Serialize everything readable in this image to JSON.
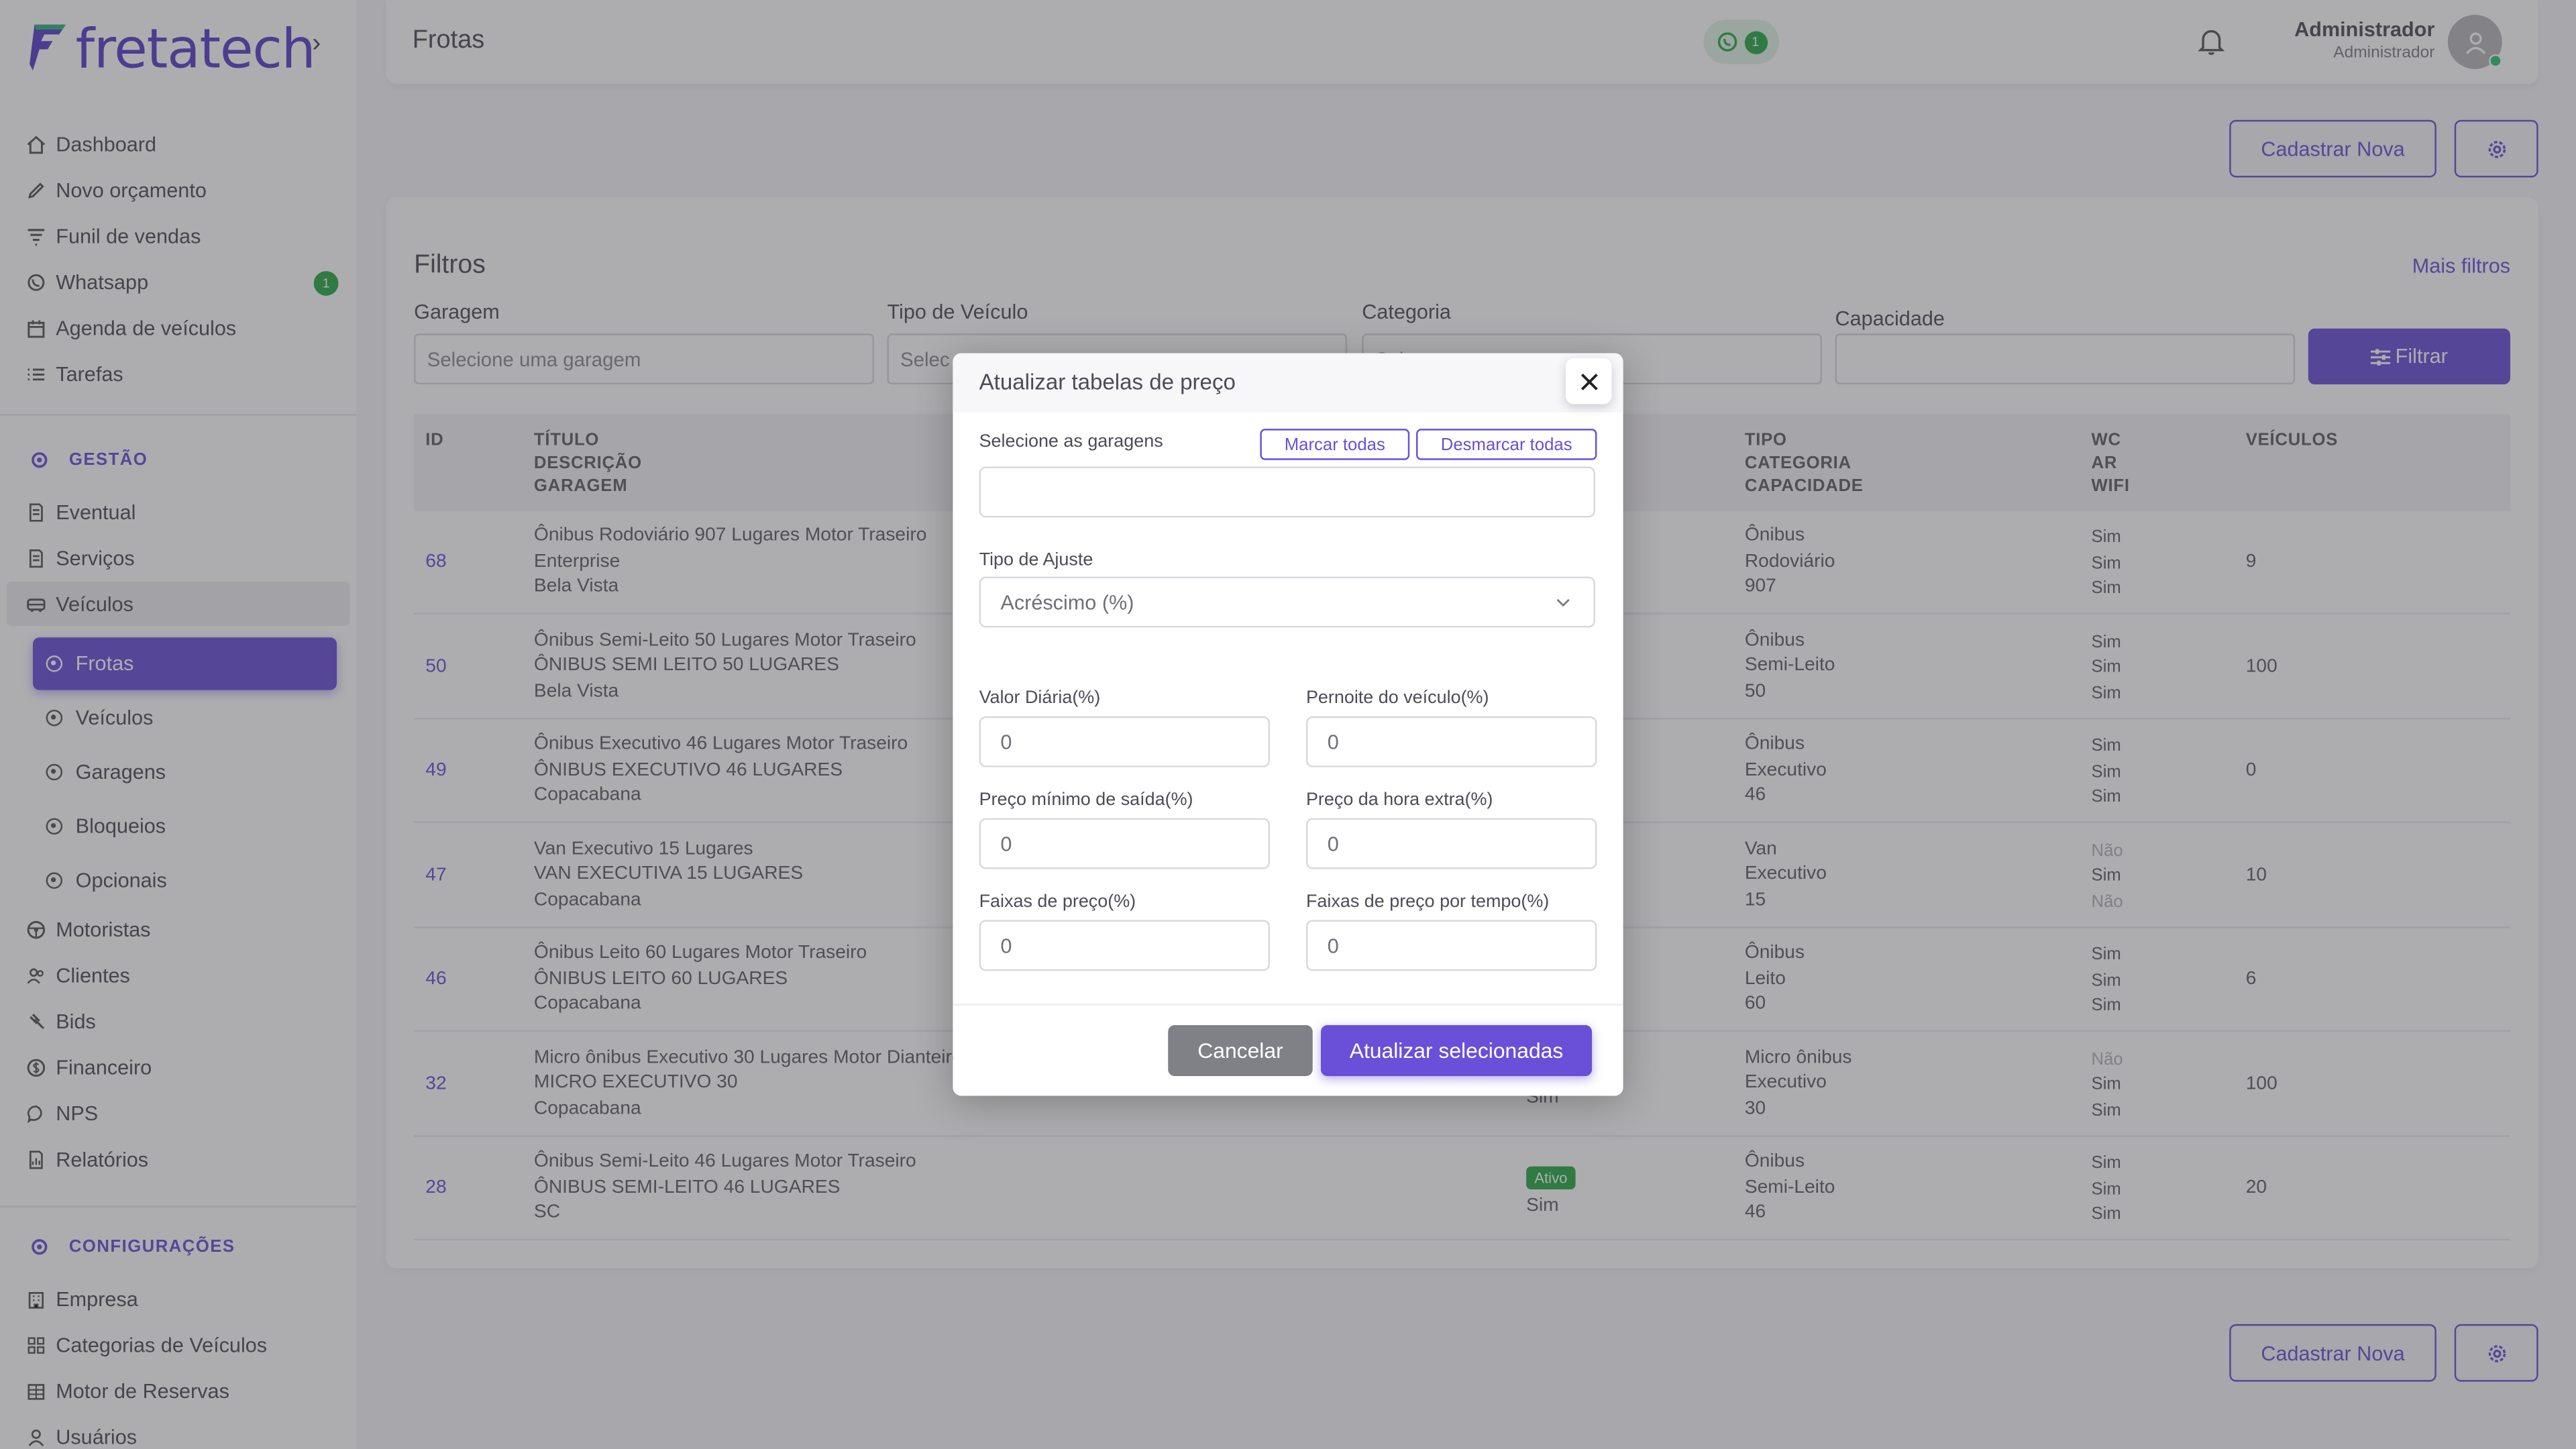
{
  "brand": {
    "name": "fretatech",
    "accent": "#6a4fd8",
    "success": "#28a745"
  },
  "sidebar": {
    "top_items": [
      {
        "label": "Dashboard",
        "icon": "home-icon"
      },
      {
        "label": "Novo orçamento",
        "icon": "edit-icon"
      },
      {
        "label": "Funil de vendas",
        "icon": "funnel-icon"
      },
      {
        "label": "Whatsapp",
        "icon": "whatsapp-icon",
        "badge": "1"
      },
      {
        "label": "Agenda de veículos",
        "icon": "calendar-icon"
      },
      {
        "label": "Tarefas",
        "icon": "list-icon"
      }
    ],
    "section_gestao": "GESTÃO",
    "gestao_items": [
      {
        "label": "Eventual",
        "icon": "document-icon"
      },
      {
        "label": "Serviços",
        "icon": "document-icon"
      },
      {
        "label": "Veículos",
        "icon": "bus-icon"
      }
    ],
    "veiculos_sub": [
      {
        "label": "Frotas",
        "active": true
      },
      {
        "label": "Veículos"
      },
      {
        "label": "Garagens"
      },
      {
        "label": "Bloqueios"
      },
      {
        "label": "Opcionais"
      }
    ],
    "more_items": [
      {
        "label": "Motoristas",
        "icon": "steering-wheel-icon"
      },
      {
        "label": "Clientes",
        "icon": "users-icon"
      },
      {
        "label": "Bids",
        "icon": "gavel-icon"
      },
      {
        "label": "Financeiro",
        "icon": "dollar-icon"
      },
      {
        "label": "NPS",
        "icon": "chat-icon"
      },
      {
        "label": "Relatórios",
        "icon": "report-icon"
      }
    ],
    "section_config": "CONFIGURAÇÕES",
    "config_items": [
      {
        "label": "Empresa",
        "icon": "building-icon"
      },
      {
        "label": "Categorias de Veículos",
        "icon": "grid-icon"
      },
      {
        "label": "Motor de Reservas",
        "icon": "table-icon"
      },
      {
        "label": "Usuários",
        "icon": "user-icon"
      }
    ]
  },
  "header": {
    "title": "Frotas",
    "whatsapp_count": "1",
    "user_name": "Administrador",
    "user_role": "Administrador"
  },
  "actions": {
    "cadastrar_label": "Cadastrar Nova"
  },
  "filters": {
    "title": "Filtros",
    "more_label": "Mais filtros",
    "garagem_label": "Garagem",
    "garagem_placeholder": "Selecione uma garagem",
    "tipo_label": "Tipo de Veículo",
    "tipo_placeholder": "Selec",
    "categoria_label": "Categoria",
    "categoria_placeholder": "Selec",
    "capacidade_label": "Capacidade",
    "filtrar_label": "Filtrar"
  },
  "table": {
    "col_id": "ID",
    "col_titulo": [
      "TÍTULO",
      "DESCRIÇÃO",
      "GARAGEM"
    ],
    "col_tipo": [
      "TIPO",
      "CATEGORIA",
      "CAPACIDADE"
    ],
    "col_amenities": [
      "WC",
      "AR",
      "WIFI"
    ],
    "col_veiculos": "VEÍCULOS",
    "rows": [
      {
        "id": "68",
        "titulo": "Ônibus Rodoviário 907 Lugares Motor Traseiro",
        "descricao": "Enterprise",
        "garagem": "Bela Vista",
        "tipo": "Ônibus",
        "categoria": "Rodoviário",
        "capacidade": "907",
        "wc": "Sim",
        "ar": "Sim",
        "wifi": "Sim",
        "veiculos": "9",
        "status": "",
        "ativo_sim": ""
      },
      {
        "id": "50",
        "titulo": "Ônibus Semi-Leito 50 Lugares Motor Traseiro",
        "descricao": "ÔNIBUS SEMI LEITO 50 LUGARES",
        "garagem": "Bela Vista",
        "tipo": "Ônibus",
        "categoria": "Semi-Leito",
        "capacidade": "50",
        "wc": "Sim",
        "ar": "Sim",
        "wifi": "Sim",
        "veiculos": "100",
        "status": "",
        "ativo_sim": ""
      },
      {
        "id": "49",
        "titulo": "Ônibus Executivo 46 Lugares Motor Traseiro",
        "descricao": "ÔNIBUS EXECUTIVO 46 LUGARES",
        "garagem": "Copacabana",
        "tipo": "Ônibus",
        "categoria": "Executivo",
        "capacidade": "46",
        "wc": "Sim",
        "ar": "Sim",
        "wifi": "Sim",
        "veiculos": "0",
        "status": "",
        "ativo_sim": ""
      },
      {
        "id": "47",
        "titulo": "Van Executivo 15 Lugares",
        "descricao": "VAN EXECUTIVA 15 LUGARES",
        "garagem": "Copacabana",
        "tipo": "Van",
        "categoria": "Executivo",
        "capacidade": "15",
        "wc": "Não",
        "ar": "Sim",
        "wifi": "Não",
        "veiculos": "10",
        "status": "",
        "ativo_sim": ""
      },
      {
        "id": "46",
        "titulo": "Ônibus Leito 60 Lugares Motor Traseiro",
        "descricao": "ÔNIBUS LEITO 60 LUGARES",
        "garagem": "Copacabana",
        "tipo": "Ônibus",
        "categoria": "Leito",
        "capacidade": "60",
        "wc": "Sim",
        "ar": "Sim",
        "wifi": "Sim",
        "veiculos": "6",
        "status": "",
        "ativo_sim": ""
      },
      {
        "id": "32",
        "titulo": "Micro ônibus Executivo 30 Lugares Motor Dianteiro",
        "descricao": "MICRO EXECUTIVO 30",
        "garagem": "Copacabana",
        "tipo": "Micro ônibus",
        "categoria": "Executivo",
        "capacidade": "30",
        "wc": "Não",
        "ar": "Sim",
        "wifi": "Sim",
        "veiculos": "100",
        "status": "",
        "ativo_sim": "Sim"
      },
      {
        "id": "28",
        "titulo": "Ônibus Semi-Leito 46 Lugares Motor Traseiro",
        "descricao": "ÔNIBUS SEMI-LEITO 46 LUGARES",
        "garagem": "SC",
        "tipo": "Ônibus",
        "categoria": "Semi-Leito",
        "capacidade": "46",
        "wc": "Sim",
        "ar": "Sim",
        "wifi": "Sim",
        "veiculos": "20",
        "status": "Ativo",
        "ativo_sim": "Sim"
      }
    ]
  },
  "modal": {
    "title": "Atualizar tabelas de preço",
    "select_garagens_label": "Selecione as garagens",
    "marcar_label": "Marcar todas",
    "desmarcar_label": "Desmarcar todas",
    "tipo_ajuste_label": "Tipo de Ajuste",
    "tipo_ajuste_value": "Acréscimo (%)",
    "fields": [
      {
        "label": "Valor Diária(%)",
        "value": "0"
      },
      {
        "label": "Pernoite do veículo(%)",
        "value": "0"
      },
      {
        "label": "Preço mínimo de saída(%)",
        "value": "0"
      },
      {
        "label": "Preço da hora extra(%)",
        "value": "0"
      },
      {
        "label": "Faixas de preço(%)",
        "value": "0"
      },
      {
        "label": "Faixas de preço por tempo(%)",
        "value": "0"
      }
    ],
    "cancel_label": "Cancelar",
    "update_label": "Atualizar selecionadas"
  }
}
